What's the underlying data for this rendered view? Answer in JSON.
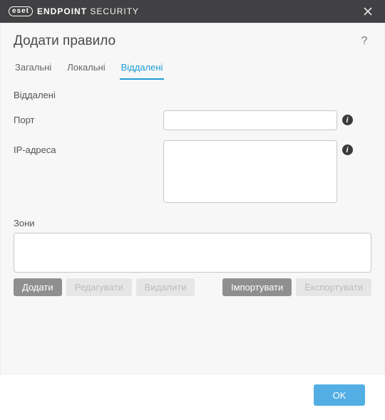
{
  "brand": {
    "mark": "eset",
    "strong": "ENDPOINT",
    "light": "SECURITY"
  },
  "page_title": "Додати правило",
  "tabs": [
    {
      "label": "Загальні",
      "active": false
    },
    {
      "label": "Локальні",
      "active": false
    },
    {
      "label": "Віддалені",
      "active": true
    }
  ],
  "section_heading": "Віддалені",
  "fields": {
    "port": {
      "label": "Порт",
      "value": ""
    },
    "ip": {
      "label": "IP-адреса",
      "value": ""
    }
  },
  "zones": {
    "label": "Зони"
  },
  "buttons": {
    "add": {
      "label": "Додати",
      "enabled": true
    },
    "edit": {
      "label": "Редагувати",
      "enabled": false
    },
    "delete": {
      "label": "Видалити",
      "enabled": false
    },
    "import": {
      "label": "Імпортувати",
      "enabled": true
    },
    "export": {
      "label": "Експортувати",
      "enabled": false
    }
  },
  "footer": {
    "ok": "OK"
  },
  "icons": {
    "info_glyph": "i",
    "help_glyph": "?"
  }
}
